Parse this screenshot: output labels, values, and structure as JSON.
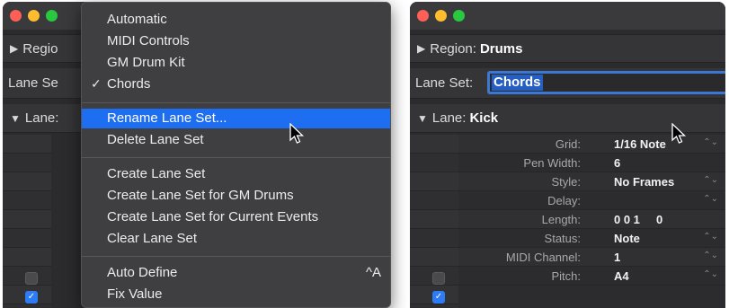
{
  "left": {
    "region_label": "Regio",
    "laneset_label": "Lane Se",
    "lane_label": "Lane:",
    "menu": {
      "items": [
        {
          "label": "Automatic",
          "checked": false,
          "highlighted": false,
          "shortcut": ""
        },
        {
          "label": "MIDI Controls",
          "checked": false,
          "highlighted": false,
          "shortcut": ""
        },
        {
          "label": "GM Drum Kit",
          "checked": false,
          "highlighted": false,
          "shortcut": ""
        },
        {
          "label": "Chords",
          "checked": true,
          "highlighted": false,
          "shortcut": ""
        },
        {
          "label": "Rename Lane Set...",
          "checked": false,
          "highlighted": true,
          "shortcut": ""
        },
        {
          "label": "Delete Lane Set",
          "checked": false,
          "highlighted": false,
          "shortcut": ""
        },
        {
          "label": "Create Lane Set",
          "checked": false,
          "highlighted": false,
          "shortcut": ""
        },
        {
          "label": "Create Lane Set for GM Drums",
          "checked": false,
          "highlighted": false,
          "shortcut": ""
        },
        {
          "label": "Create Lane Set for Current Events",
          "checked": false,
          "highlighted": false,
          "shortcut": ""
        },
        {
          "label": "Clear Lane Set",
          "checked": false,
          "highlighted": false,
          "shortcut": ""
        },
        {
          "label": "Auto Define",
          "checked": false,
          "highlighted": false,
          "shortcut": "^A"
        },
        {
          "label": "Fix Value",
          "checked": false,
          "highlighted": false,
          "shortcut": ""
        }
      ],
      "check_mark": "✓"
    }
  },
  "right": {
    "region_label": "Region:",
    "region_value": "Drums",
    "laneset_label": "Lane Set:",
    "laneset_value": "Chords",
    "lane_label": "Lane:",
    "lane_value": "Kick",
    "params": [
      {
        "label": "Grid:",
        "value": "1/16 Note",
        "stepper": true
      },
      {
        "label": "Pen Width:",
        "value": "6",
        "stepper": false
      },
      {
        "label": "Style:",
        "value": "No Frames",
        "stepper": true
      },
      {
        "label": "Delay:",
        "value": "",
        "stepper": true
      },
      {
        "label": "Length:",
        "value": "0 0 1     0",
        "stepper": false
      },
      {
        "label": "Status:",
        "value": "Note",
        "stepper": true
      },
      {
        "label": "MIDI Channel:",
        "value": "1",
        "stepper": true
      },
      {
        "label": "Pitch:",
        "value": "A4",
        "stepper": true
      }
    ]
  },
  "colors": {
    "highlight": "#1e6ef2",
    "checkbox_on": "#2d7cf6",
    "field_focus": "#3b78d4"
  },
  "icons": {
    "disclosure_closed": "▶",
    "disclosure_open": "▼",
    "stepper": "⌃⌄"
  }
}
